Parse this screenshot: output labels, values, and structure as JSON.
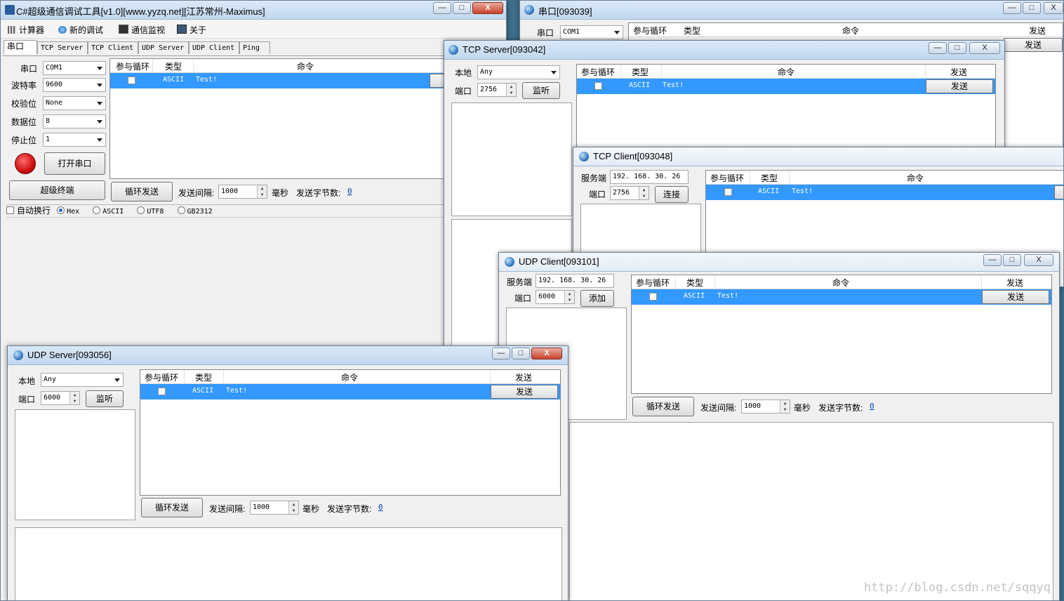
{
  "main": {
    "title": "C#超级通信调试工具[v1.0][www.yyzq.net][江苏常州-Maximus]",
    "menu": [
      "计算器",
      "新的调试",
      "通信监视",
      "关于"
    ],
    "tabs": [
      "串口",
      "TCP Server",
      "TCP Client",
      "UDP Server",
      "UDP Client",
      "Ping"
    ],
    "labels": {
      "port": "串口",
      "baud": "波特率",
      "parity": "校验位",
      "databits": "数据位",
      "stopbits": "停止位"
    },
    "values": {
      "port": "COM1",
      "baud": "9600",
      "parity": "None",
      "databits": "8",
      "stopbits": "1"
    },
    "open_button": "打开串口",
    "terminal_button": "超级终端",
    "loop_button": "循环发送",
    "interval_label": "发送间隔:",
    "interval_value": "1000",
    "ms_label": "毫秒",
    "bytes_label": "发送字节数:",
    "bytes_value": "0",
    "auto_newline": "自动换行",
    "encodings": [
      "Hex",
      "ASCII",
      "UTF8",
      "GB2312"
    ]
  },
  "grid": {
    "headers": {
      "loop": "参与循环",
      "type": "类型",
      "command": "命令",
      "send": "发送"
    },
    "row": {
      "type": "ASCII",
      "command": "Test!",
      "send": "发送"
    }
  },
  "serial_win": {
    "title": "串口[093039]",
    "port_label": "串口",
    "port_value": "COM1"
  },
  "tcp_server": {
    "title": "TCP Server[093042]",
    "local_label": "本地",
    "local_value": "Any",
    "port_label": "端口",
    "port_value": "2756",
    "listen_button": "监听"
  },
  "tcp_client": {
    "title": "TCP Client[093048]",
    "server_label": "服务端",
    "server_value": "192. 168. 30. 26",
    "port_label": "端口",
    "port_value": "2756",
    "connect_button": "连接"
  },
  "udp_client": {
    "title": "UDP Client[093101]",
    "server_label": "服务端",
    "server_value": "192. 168. 30. 26",
    "port_label": "端口",
    "port_value": "6000",
    "add_button": "添加",
    "loop_button": "循环发送",
    "interval_label": "发送间隔:",
    "interval_value": "1000",
    "ms_label": "毫秒",
    "bytes_label": "发送字节数:",
    "bytes_value": "0"
  },
  "udp_server": {
    "title": "UDP Server[093056]",
    "local_label": "本地",
    "local_value": "Any",
    "port_label": "端口",
    "port_value": "6000",
    "listen_button": "监听",
    "loop_button": "循环发送",
    "interval_label": "发送间隔:",
    "interval_value": "1000",
    "ms_label": "毫秒",
    "bytes_label": "发送字节数:",
    "bytes_value": "0"
  },
  "window_controls": {
    "minimize": "—",
    "maximize": "□",
    "close": "X"
  },
  "watermark": "http://blog.csdn.net/sqqyq",
  "colors": {
    "selection": "#3399ff",
    "titlebar": "#c2d8ef",
    "record_button": "#d01010"
  }
}
